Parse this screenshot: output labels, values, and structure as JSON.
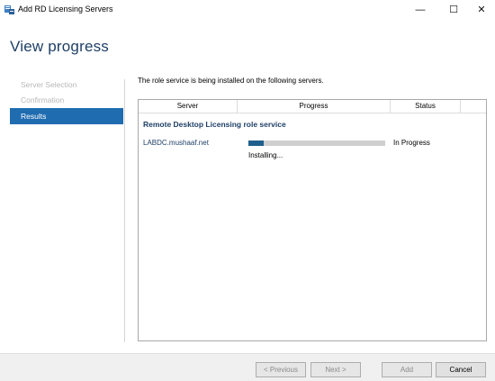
{
  "window": {
    "title": "Add RD Licensing Servers",
    "minimize_glyph": "—",
    "maximize_glyph": "☐",
    "close_glyph": "✕",
    "icon": "server-manager-icon"
  },
  "header": {
    "title": "View progress"
  },
  "nav": {
    "items": [
      {
        "label": "Server Selection",
        "state": "disabled"
      },
      {
        "label": "Confirmation",
        "state": "disabled"
      },
      {
        "label": "Results",
        "state": "active"
      }
    ]
  },
  "main": {
    "intro": "The role service is being installed on the following servers.",
    "columns": {
      "server": "Server",
      "progress": "Progress",
      "status": "Status"
    },
    "group_title": "Remote Desktop Licensing role service",
    "rows": [
      {
        "server": "LABDC.mushaaf.net",
        "progress": 0.11,
        "status": "In Progress",
        "detail": "Installing..."
      }
    ]
  },
  "footer": {
    "previous": "< Previous",
    "next": "Next >",
    "add": "Add",
    "cancel": "Cancel"
  },
  "colors": {
    "accent": "#1f6cb0",
    "title": "#1e3f66",
    "progress_fill": "#1f5f8b",
    "progress_track": "#cfcfcf"
  }
}
